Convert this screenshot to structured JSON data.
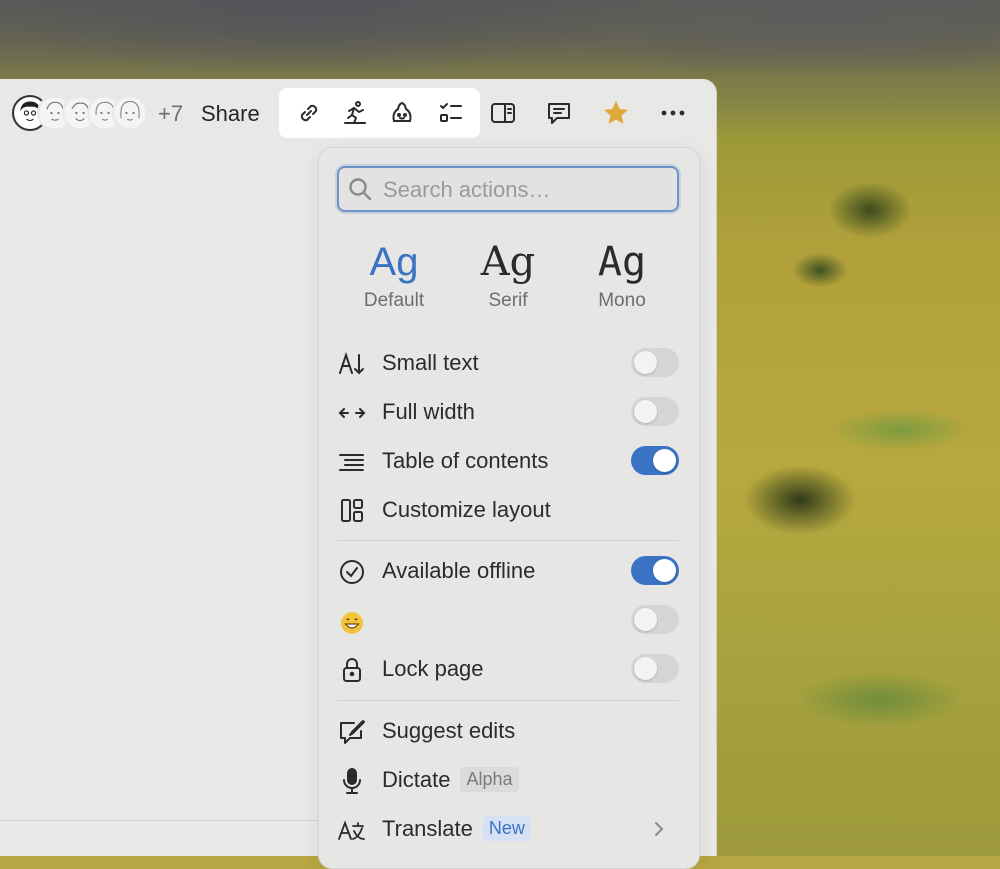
{
  "header": {
    "more_collaborators": "+7",
    "share_label": "Share",
    "star_color": "#e0a93b"
  },
  "menu": {
    "search_placeholder": "Search actions…",
    "fonts": [
      {
        "sample": "Ag",
        "label": "Default"
      },
      {
        "sample": "Ag",
        "label": "Serif"
      },
      {
        "sample": "Ag",
        "label": "Mono"
      }
    ],
    "items": {
      "small_text": {
        "label": "Small text",
        "on": false
      },
      "full_width": {
        "label": "Full width",
        "on": false
      },
      "toc": {
        "label": "Table of contents",
        "on": true
      },
      "customize": {
        "label": "Customize layout"
      },
      "offline": {
        "label": "Available offline",
        "on": true
      },
      "emoji": {
        "label": "😄",
        "on": false
      },
      "lock": {
        "label": "Lock page",
        "on": false
      },
      "suggest": {
        "label": "Suggest edits"
      },
      "dictate": {
        "label": "Dictate",
        "badge": "Alpha"
      },
      "translate": {
        "label": "Translate",
        "badge": "New"
      }
    },
    "accent_color": "#3b73c4"
  }
}
